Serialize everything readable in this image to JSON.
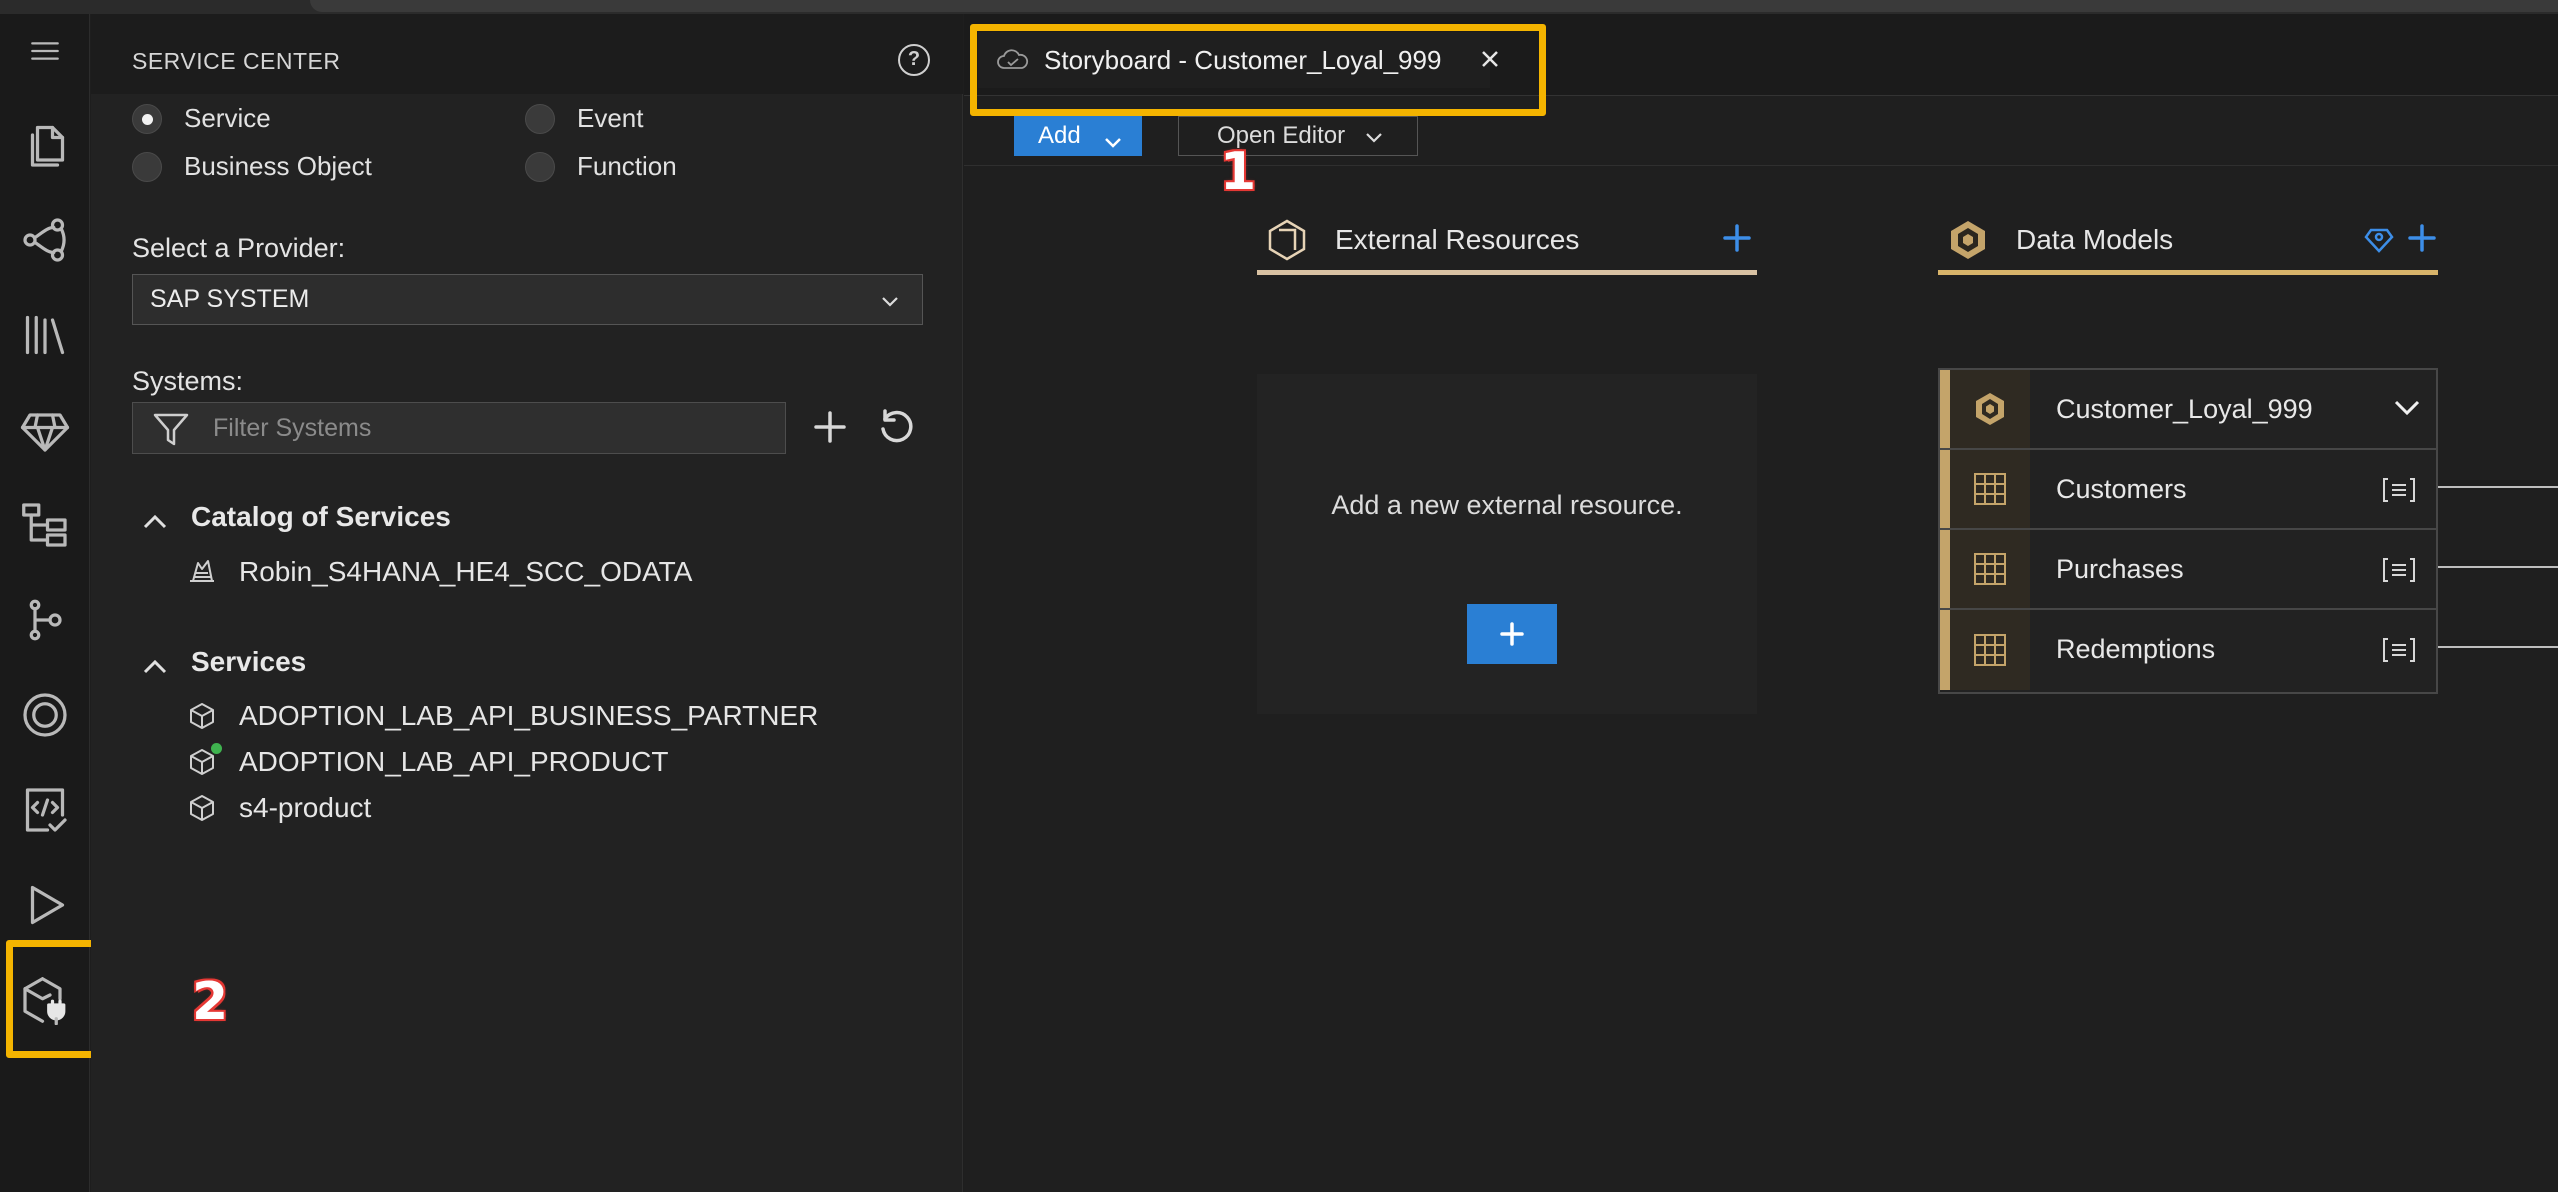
{
  "sidebar": {
    "title": "SERVICE CENTER",
    "radio_options": [
      {
        "label": "Service",
        "selected": true
      },
      {
        "label": "Event",
        "selected": false
      },
      {
        "label": "Business Object",
        "selected": false
      },
      {
        "label": "Function",
        "selected": false
      }
    ],
    "provider_label": "Select a Provider:",
    "provider_value": "SAP SYSTEM",
    "systems_label": "Systems:",
    "filter_placeholder": "Filter Systems",
    "catalog": {
      "title": "Catalog of Services",
      "items": [
        "Robin_S4HANA_HE4_SCC_ODATA"
      ]
    },
    "services": {
      "title": "Services",
      "items": [
        {
          "label": "ADOPTION_LAB_API_BUSINESS_PARTNER",
          "status": ""
        },
        {
          "label": "ADOPTION_LAB_API_PRODUCT",
          "status": "green"
        },
        {
          "label": "s4-product",
          "status": ""
        }
      ]
    }
  },
  "activity_bar": {
    "icons": [
      "menu-icon",
      "explorer-icon",
      "source-control-icon",
      "library-icon",
      "gem-icon",
      "hierarchy-icon",
      "git-branch-icon",
      "at-ring-icon",
      "code-check-icon",
      "run-icon",
      "service-center-icon"
    ]
  },
  "editor": {
    "tab_label": "Storyboard - Customer_Loyal_999",
    "toolbar": {
      "add_label": "Add",
      "open_editor_label": "Open Editor"
    },
    "external_resources": {
      "title": "External Resources",
      "empty_text": "Add a new external resource."
    },
    "data_models": {
      "title": "Data Models",
      "header_row": "Customer_Loyal_999",
      "entities": [
        "Customers",
        "Purchases",
        "Redemptions"
      ]
    }
  },
  "callouts": [
    "1",
    "2"
  ],
  "colors": {
    "accent_blue": "#2a7fd4",
    "highlight_yellow": "#f4b400",
    "gold": "#c4a46a",
    "status_green": "#3fb34f"
  }
}
